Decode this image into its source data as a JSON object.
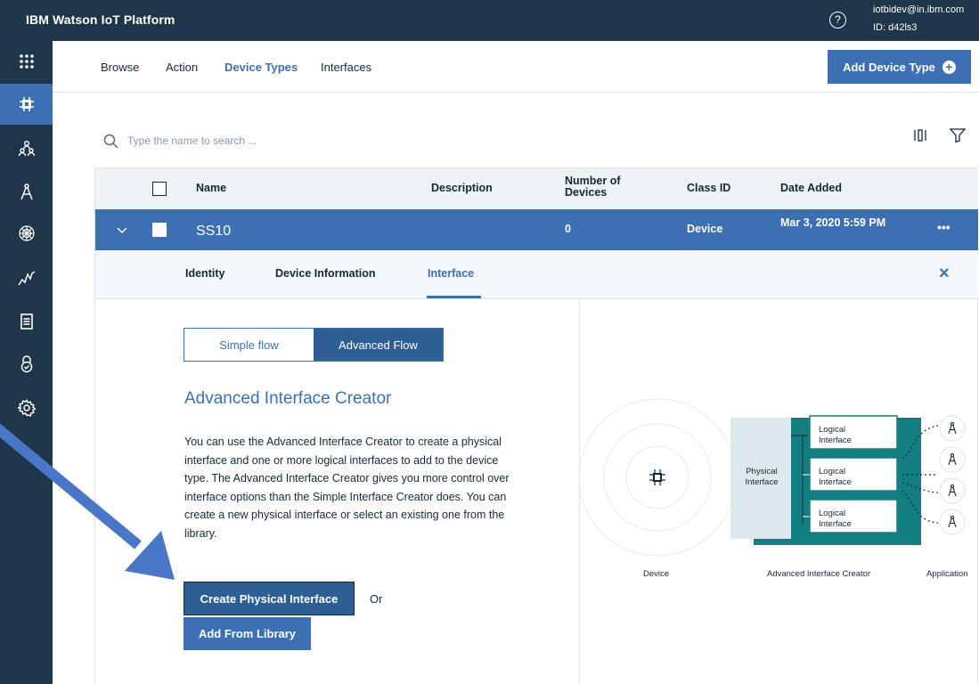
{
  "topbar": {
    "brand": "IBM Watson IoT Platform",
    "help_glyph": "?",
    "user_email": "iotbidev@in.ibm.com",
    "user_id": "ID: d42ls3"
  },
  "sidebar": {
    "items": [
      {
        "icon": "app-grid-icon"
      },
      {
        "icon": "device-chip-icon",
        "active": true
      },
      {
        "icon": "members-icon"
      },
      {
        "icon": "apps-compass-icon"
      },
      {
        "icon": "blockchain-icon"
      },
      {
        "icon": "usage-chart-icon"
      },
      {
        "icon": "rules-document-icon"
      },
      {
        "icon": "security-lock-icon"
      },
      {
        "icon": "settings-gear-icon"
      }
    ]
  },
  "nav": {
    "tabs": [
      {
        "label": "Browse"
      },
      {
        "label": "Action"
      },
      {
        "label": "Device Types",
        "active": true
      },
      {
        "label": "Interfaces"
      }
    ],
    "add_button": "Add Device Type"
  },
  "search": {
    "placeholder": "Type the name to search ..."
  },
  "table": {
    "headers": {
      "name": "Name",
      "description": "Description",
      "num_devices": "Number of Devices",
      "class_id": "Class ID",
      "date_added": "Date Added"
    },
    "row": {
      "name": "SS10",
      "description": "",
      "num_devices": "0",
      "class_id": "Device",
      "date_added": "Mar 3, 2020 5:59 PM",
      "menu": "•••"
    }
  },
  "detail": {
    "tabs": [
      {
        "label": "Identity"
      },
      {
        "label": "Device Information"
      },
      {
        "label": "Interface",
        "active": true
      }
    ],
    "close": "×",
    "flow": {
      "simple": "Simple flow",
      "advanced": "Advanced Flow",
      "selected": "advanced"
    },
    "title": "Advanced Interface Creator",
    "description": "You can use the Advanced Interface Creator to create a physical interface and one or more logical interfaces to add to the device type. The Advanced Interface Creator gives you more control over interface options than the Simple Interface Creator does. You can create a new physical interface or select an existing one from the library.",
    "create_button": "Create Physical Interface",
    "or_text": "Or",
    "library_button": "Add From Library"
  },
  "diagram": {
    "physical": "Physical Interface",
    "logical": [
      "Logical Interface",
      "Logical Interface",
      "Logical Interface"
    ],
    "label_device": "Device",
    "label_creator": "Advanced Interface Creator",
    "label_application": "Application",
    "colors": {
      "teal": "#137e80",
      "panel": "#dde8ec"
    }
  },
  "colors": {
    "navy": "#1d3649",
    "blue": "#3d70b2",
    "dark_blue": "#2d5f94",
    "arrow": "#4a76c7"
  }
}
